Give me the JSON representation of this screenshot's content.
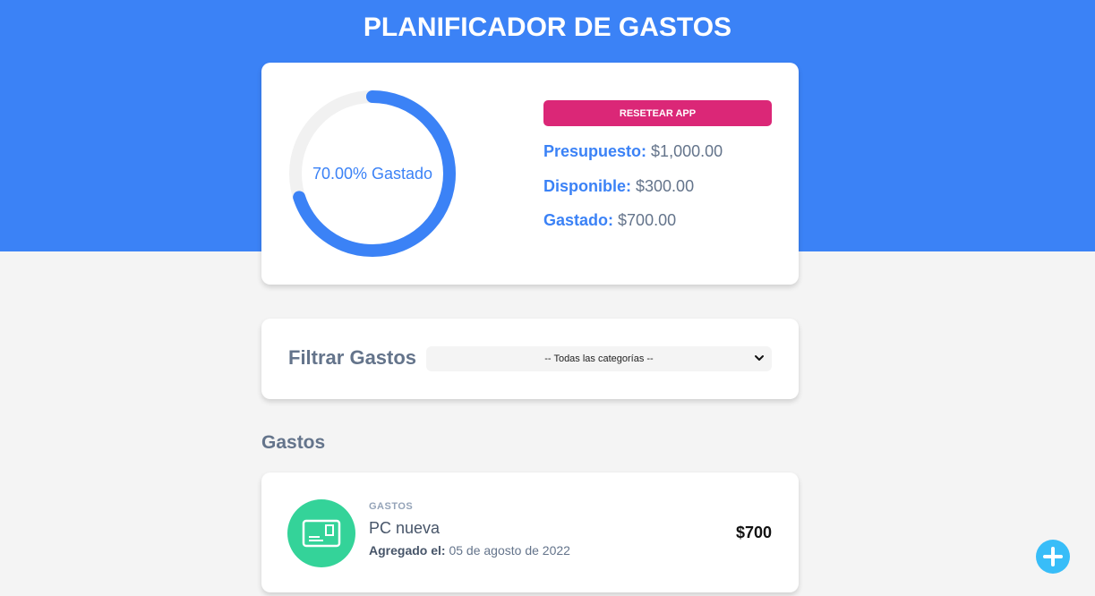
{
  "header": {
    "title": "PLANIFICADOR DE GASTOS",
    "bg_color": "#3b82f6"
  },
  "budget": {
    "progress_label": "70.00% Gastado",
    "progress_fraction": 0.7,
    "reset_label": "Resetear App",
    "stats": [
      {
        "label": "Presupuesto:",
        "value": "$1,000.00"
      },
      {
        "label": "Disponible:",
        "value": "$300.00"
      },
      {
        "label": "Gastado:",
        "value": "$700.00"
      }
    ]
  },
  "filter": {
    "label": "Filtrar Gastos",
    "selected": "-- Todas las categorías --"
  },
  "expenses": {
    "title": "Gastos",
    "items": [
      {
        "category": "Gastos",
        "name": "PC nueva",
        "date_label": "Agregado el:",
        "date_value": "05 de agosto de 2022",
        "amount": "$700",
        "icon": "expense-card-icon"
      }
    ]
  },
  "fab": {
    "icon": "plus-icon"
  },
  "colors": {
    "accent": "#3b82f6",
    "reset": "#db2777",
    "icon_bg": "#34d399",
    "fab": "#38bdf8"
  }
}
